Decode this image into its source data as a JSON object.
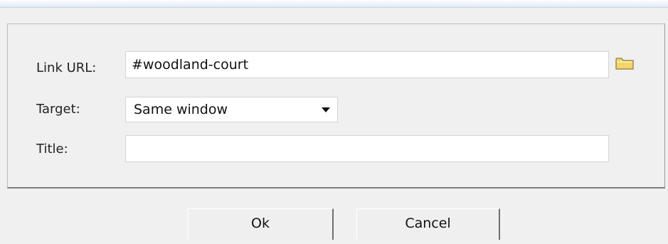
{
  "dialog": {
    "link_url_label": "Link URL:",
    "link_url_value": "#woodland-court",
    "browse_icon": "folder-icon",
    "target_label": "Target:",
    "target_selected": "Same window",
    "title_label": "Title:",
    "title_value": ""
  },
  "buttons": {
    "ok_label": "Ok",
    "cancel_label": "Cancel"
  },
  "colors": {
    "background": "#f0f0f0",
    "input_background": "#ffffff",
    "folder_yellow": "#f2d66b"
  }
}
